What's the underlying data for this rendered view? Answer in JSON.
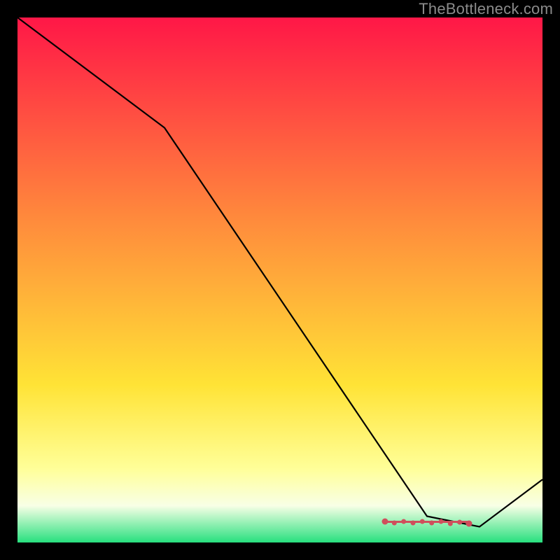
{
  "watermark": "TheBottleneck.com",
  "colors": {
    "top": "#ff1747",
    "mid1": "#ff893c",
    "mid2": "#ffe336",
    "low": "#ffff99",
    "white": "#f8ffe6",
    "bottom": "#27e07e",
    "line": "#000000",
    "marker": "#cf4f5c"
  },
  "chart_data": {
    "type": "line",
    "title": "",
    "xlabel": "",
    "ylabel": "",
    "xlim": [
      0,
      100
    ],
    "ylim": [
      0,
      100
    ],
    "main_line": {
      "x": [
        0,
        28,
        78,
        88,
        100
      ],
      "y": [
        100,
        79,
        5,
        3,
        12
      ]
    },
    "marker_series": {
      "x_start": 70,
      "x_end": 86,
      "y": 4
    }
  }
}
